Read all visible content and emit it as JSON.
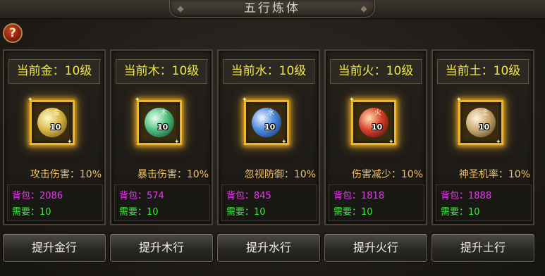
{
  "window": {
    "title": "五行炼体"
  },
  "help": {
    "label": "?"
  },
  "elements": [
    {
      "level": "当前金：10级",
      "glyph": "金",
      "count": "10",
      "attribute": "攻击伤害：10%",
      "bag": "背包：2086",
      "need": "需要：10",
      "button": "提升金行",
      "orb_color": "#d8b84a"
    },
    {
      "level": "当前木：10级",
      "glyph": "木",
      "count": "10",
      "attribute": "暴击伤害：10%",
      "bag": "背包：574",
      "need": "需要：10",
      "button": "提升木行",
      "orb_color": "#4ec080"
    },
    {
      "level": "当前水：10级",
      "glyph": "水",
      "count": "10",
      "attribute": "忽视防御：10%",
      "bag": "背包：845",
      "need": "需要：10",
      "button": "提升水行",
      "orb_color": "#4a8ae0"
    },
    {
      "level": "当前火：10级",
      "glyph": "火",
      "count": "10",
      "attribute": "伤害减少：10%",
      "bag": "背包：1818",
      "need": "需要：10",
      "button": "提升火行",
      "orb_color": "#d8402a"
    },
    {
      "level": "当前土：10级",
      "glyph": "土",
      "count": "10",
      "attribute": "神圣机率：10%",
      "bag": "背包：1888",
      "need": "需要：10",
      "button": "提升土行",
      "orb_color": "#c8a870"
    }
  ],
  "colors": {
    "level_text": "#f2e64a",
    "attribute_text": "#f0c060",
    "bag_text": "#e040e8",
    "need_text": "#3ee640",
    "icon_glow": "#e8b830"
  }
}
